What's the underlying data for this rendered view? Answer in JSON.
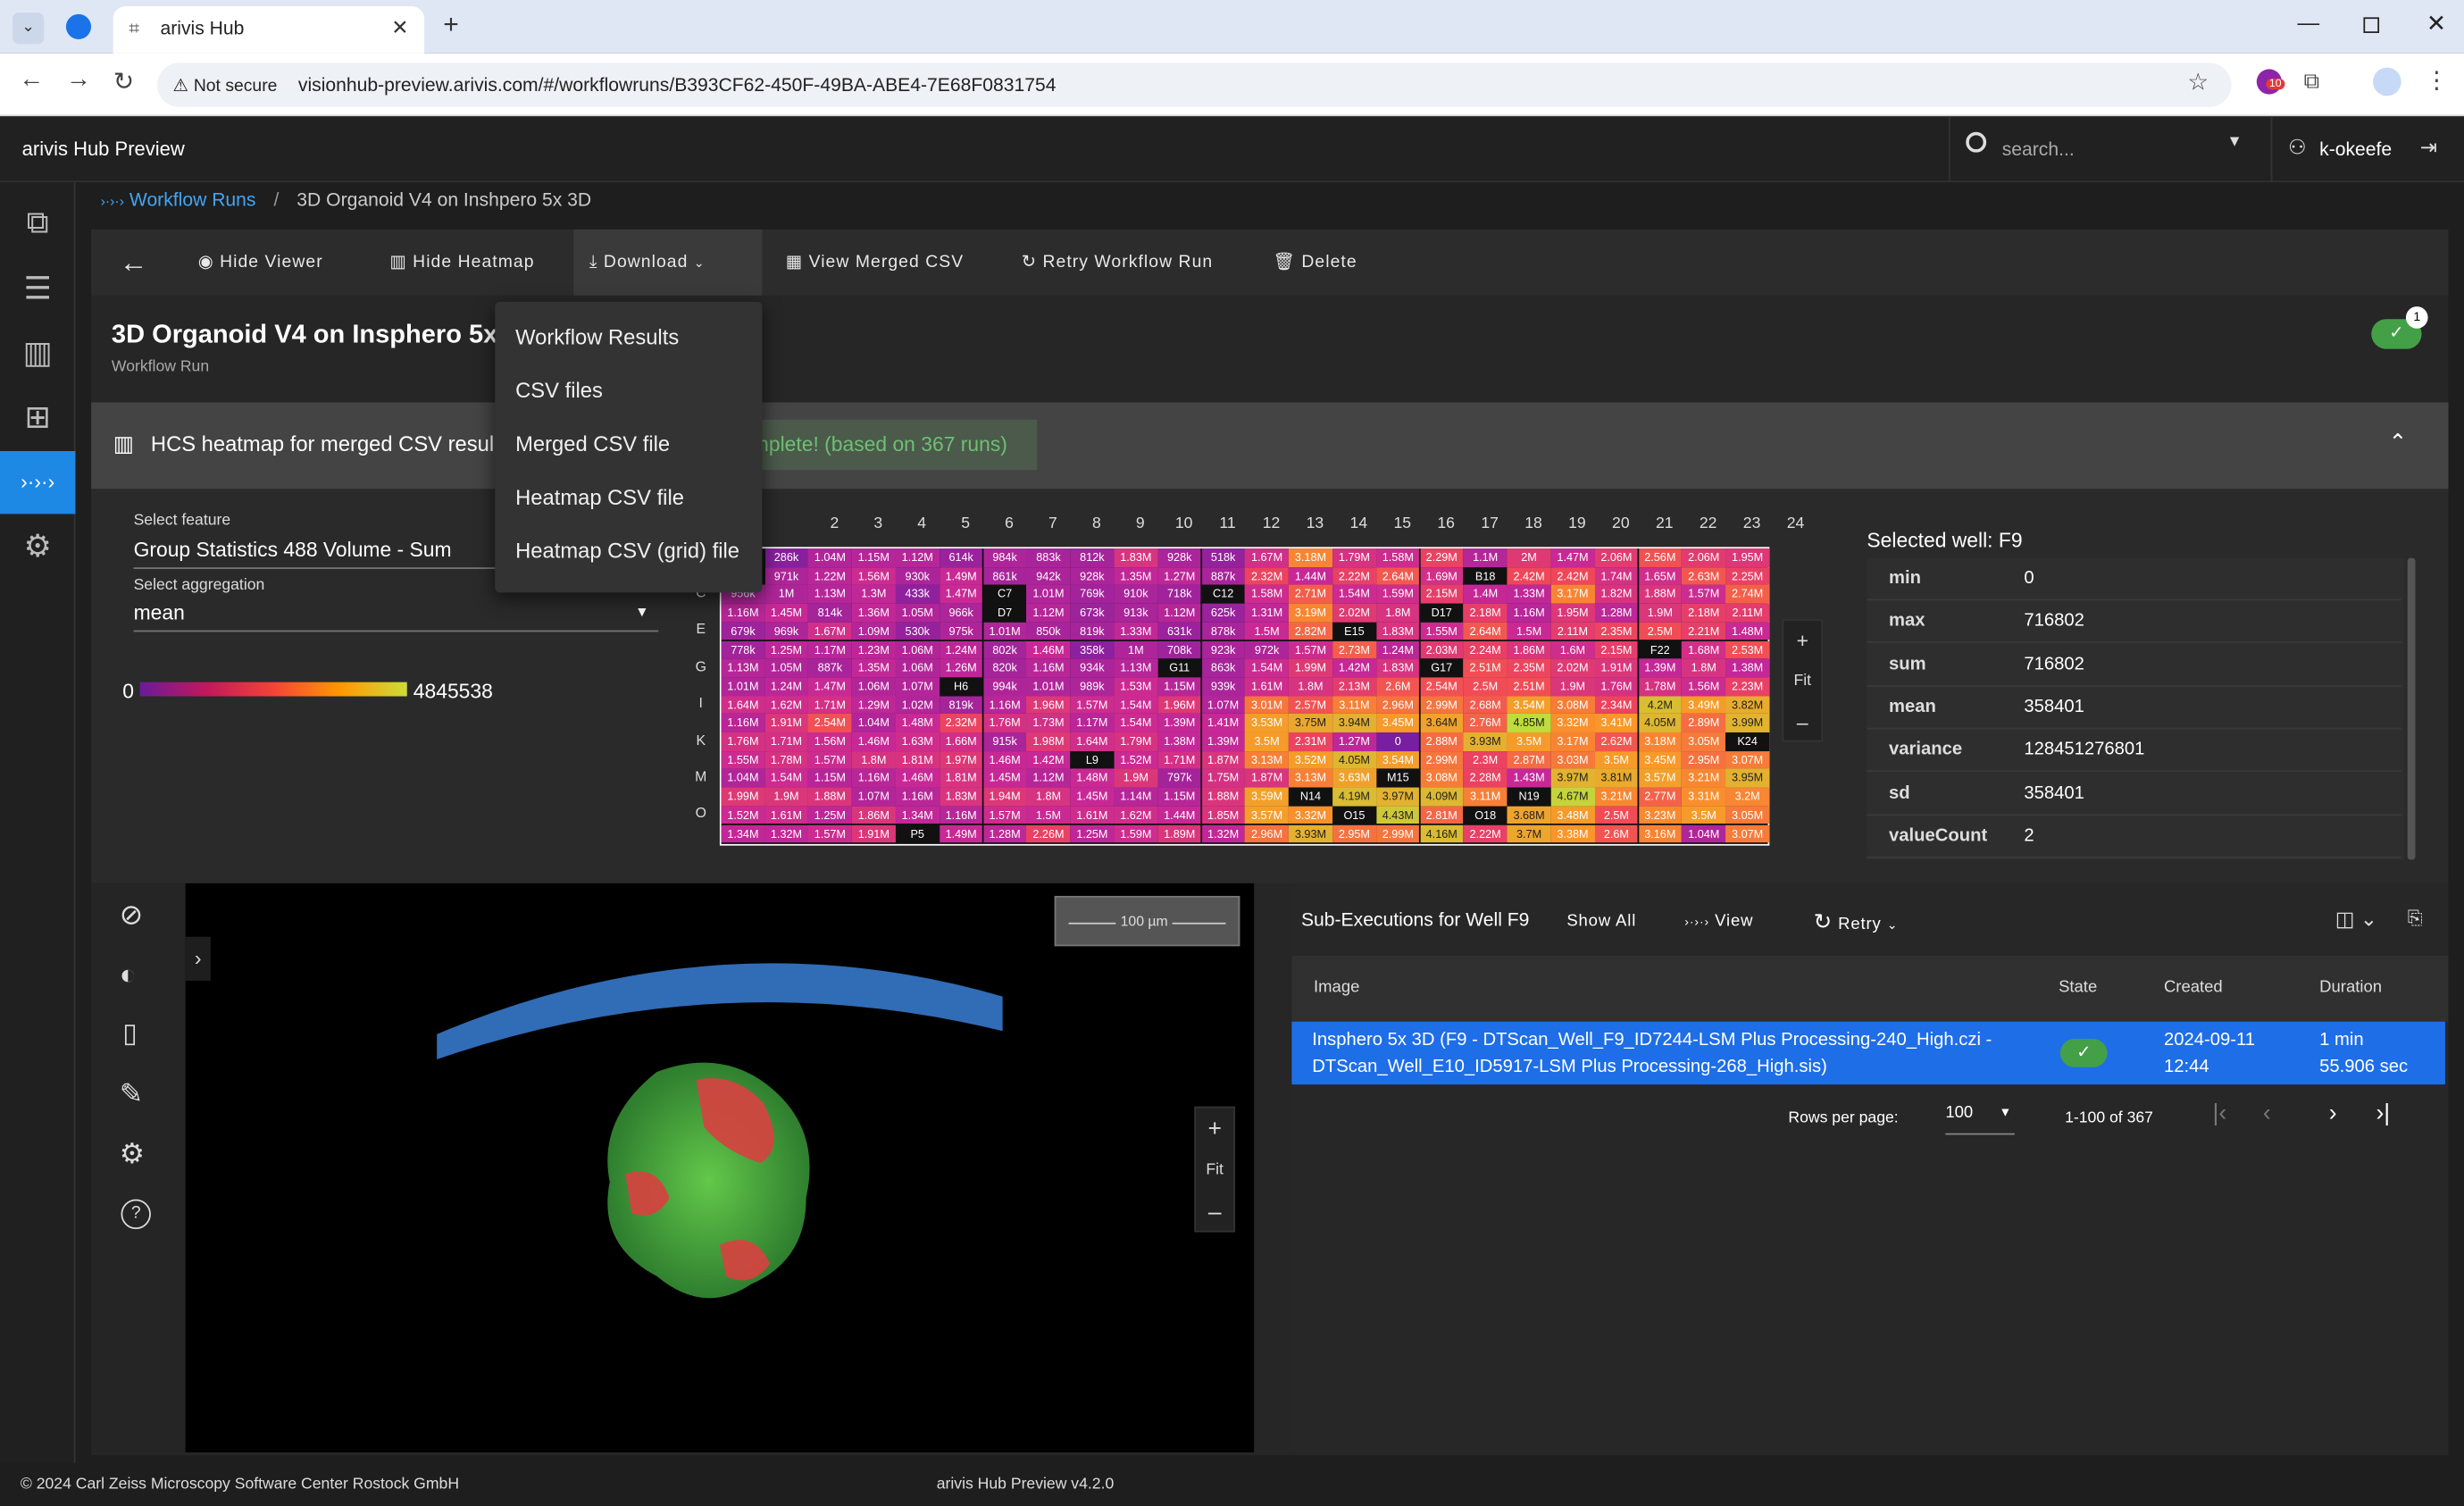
{
  "browser": {
    "tab_title": "arivis Hub",
    "security_label": "Not secure",
    "url": "visionhub-preview.arivis.com/#/workflowruns/B393CF62-450F-49BA-ABE4-7E68F0831754",
    "ext_badge": "10"
  },
  "app": {
    "title": "arivis Hub Preview",
    "search_placeholder": "search...",
    "user": "k-okeefe"
  },
  "breadcrumb": {
    "parent": "Workflow Runs",
    "separator": "/",
    "current": "3D Organoid V4 on Inshpero 5x 3D"
  },
  "toolbar": {
    "hide_viewer": "Hide Viewer",
    "hide_heatmap": "Hide Heatmap",
    "download": "Download",
    "view_merged_csv": "View Merged CSV",
    "retry": "Retry Workflow Run",
    "delete": "Delete"
  },
  "download_menu": [
    "Workflow Results",
    "CSV files",
    "Merged CSV file",
    "Heatmap CSV file",
    "Heatmap CSV (grid) file"
  ],
  "run": {
    "title": "3D Organoid V4 on Insphero 5x",
    "subtitle": "Workflow Run",
    "badge_count": "1"
  },
  "heatmap": {
    "header": "HCS heatmap for merged CSV resul",
    "status": "nplete! (based on 367 runs)",
    "feature_label": "Select feature",
    "feature_value": "Group Statistics 488 Volume - Sum",
    "agg_label": "Select aggregation",
    "agg_value": "mean",
    "scale_min": "0",
    "scale_max": "4845538",
    "columns": [
      "2",
      "3",
      "4",
      "5",
      "6",
      "7",
      "8",
      "9",
      "10",
      "11",
      "12",
      "13",
      "14",
      "15",
      "16",
      "17",
      "18",
      "19",
      "20",
      "21",
      "22",
      "23",
      "24"
    ],
    "row_labels": [
      "C",
      "E",
      "G",
      "I",
      "K",
      "M",
      "O"
    ],
    "zoom_fit": "Fit",
    "rows": [
      [
        "286k",
        "1.04M",
        "1.15M",
        "1.12M",
        "614k",
        "984k",
        "883k",
        "812k",
        "1.83M",
        "928k",
        "518k",
        "1.67M",
        "3.18M",
        "1.79M",
        "1.58M",
        "2.29M",
        "1.1M",
        "2M",
        "1.47M",
        "2.06M",
        "2.56M",
        "2.06M",
        "1.95M"
      ],
      [
        "971k",
        "1.22M",
        "1.56M",
        "930k",
        "1.49M",
        "861k",
        "942k",
        "928k",
        "1.35M",
        "1.27M",
        "887k",
        "2.32M",
        "1.44M",
        "2.22M",
        "2.64M",
        "1.69M",
        "B18",
        "2.42M",
        "2.42M",
        "1.74M",
        "1.65M",
        "2.63M",
        "2.25M"
      ],
      [
        "1M",
        "1.13M",
        "1.3M",
        "433k",
        "1.47M",
        "C7",
        "1.01M",
        "769k",
        "910k",
        "718k",
        "C12",
        "1.58M",
        "2.71M",
        "1.54M",
        "1.59M",
        "2.15M",
        "1.4M",
        "1.33M",
        "3.17M",
        "1.82M",
        "1.88M",
        "1.57M",
        "2.74M"
      ],
      [
        "1.45M",
        "814k",
        "1.36M",
        "1.05M",
        "966k",
        "D7",
        "1.12M",
        "673k",
        "913k",
        "1.12M",
        "625k",
        "1.31M",
        "3.19M",
        "2.02M",
        "1.8M",
        "D17",
        "2.18M",
        "1.16M",
        "1.95M",
        "1.28M",
        "1.9M",
        "2.18M",
        "2.11M"
      ],
      [
        "969k",
        "1.67M",
        "1.09M",
        "530k",
        "975k",
        "1.01M",
        "850k",
        "819k",
        "1.33M",
        "631k",
        "878k",
        "1.5M",
        "2.82M",
        "E15",
        "1.83M",
        "1.55M",
        "2.64M",
        "1.5M",
        "2.11M",
        "2.35M",
        "2.5M",
        "2.21M",
        "1.48M"
      ],
      [
        "1.25M",
        "1.17M",
        "1.23M",
        "1.06M",
        "1.24M",
        "802k",
        "1.46M",
        "358k",
        "1M",
        "708k",
        "923k",
        "972k",
        "1.57M",
        "2.73M",
        "1.24M",
        "2.03M",
        "2.24M",
        "1.86M",
        "1.6M",
        "2.15M",
        "F22",
        "1.68M",
        "2.53M"
      ],
      [
        "1.05M",
        "887k",
        "1.35M",
        "1.06M",
        "1.26M",
        "820k",
        "1.16M",
        "934k",
        "1.13M",
        "G11",
        "863k",
        "1.54M",
        "1.99M",
        "1.42M",
        "1.83M",
        "G17",
        "2.51M",
        "2.35M",
        "2.02M",
        "1.91M",
        "1.39M",
        "1.8M",
        "1.38M"
      ],
      [
        "1.24M",
        "1.47M",
        "1.06M",
        "1.07M",
        "H6",
        "994k",
        "1.01M",
        "989k",
        "1.53M",
        "1.15M",
        "939k",
        "1.61M",
        "1.8M",
        "2.13M",
        "2.6M",
        "2.54M",
        "2.5M",
        "2.51M",
        "1.9M",
        "1.76M",
        "1.78M",
        "1.56M",
        "2.23M"
      ],
      [
        "1.62M",
        "1.71M",
        "1.29M",
        "1.02M",
        "819k",
        "1.16M",
        "1.96M",
        "1.57M",
        "1.54M",
        "1.96M",
        "1.07M",
        "3.01M",
        "2.57M",
        "3.11M",
        "2.96M",
        "2.99M",
        "2.68M",
        "3.54M",
        "3.08M",
        "2.34M",
        "4.2M",
        "3.49M",
        "3.82M"
      ],
      [
        "1.91M",
        "2.54M",
        "1.04M",
        "1.48M",
        "2.32M",
        "1.76M",
        "1.73M",
        "1.17M",
        "1.54M",
        "1.39M",
        "1.41M",
        "3.53M",
        "3.75M",
        "3.94M",
        "3.45M",
        "3.64M",
        "2.76M",
        "4.85M",
        "3.32M",
        "3.41M",
        "4.05M",
        "2.89M",
        "3.99M"
      ],
      [
        "1.71M",
        "1.56M",
        "1.46M",
        "1.63M",
        "1.66M",
        "915k",
        "1.98M",
        "1.64M",
        "1.79M",
        "1.38M",
        "1.39M",
        "3.5M",
        "2.31M",
        "1.27M",
        "0",
        "2.88M",
        "3.93M",
        "3.5M",
        "3.17M",
        "2.62M",
        "3.18M",
        "3.05M",
        "K24"
      ],
      [
        "1.78M",
        "1.57M",
        "1.8M",
        "1.81M",
        "1.97M",
        "1.46M",
        "1.42M",
        "L9",
        "1.52M",
        "1.71M",
        "1.87M",
        "3.13M",
        "3.52M",
        "4.05M",
        "3.54M",
        "2.99M",
        "2.3M",
        "2.87M",
        "3.03M",
        "3.5M",
        "3.45M",
        "2.95M",
        "3.07M"
      ],
      [
        "1.54M",
        "1.15M",
        "1.16M",
        "1.46M",
        "1.81M",
        "1.45M",
        "1.12M",
        "1.48M",
        "1.9M",
        "797k",
        "1.75M",
        "1.87M",
        "3.13M",
        "3.63M",
        "M15",
        "3.08M",
        "2.28M",
        "1.43M",
        "3.97M",
        "3.81M",
        "3.57M",
        "3.21M",
        "3.95M"
      ],
      [
        "1.9M",
        "1.88M",
        "1.07M",
        "1.16M",
        "1.83M",
        "1.94M",
        "1.8M",
        "1.45M",
        "1.14M",
        "1.15M",
        "1.88M",
        "3.59M",
        "N14",
        "4.19M",
        "3.97M",
        "4.09M",
        "3.11M",
        "N19",
        "4.67M",
        "3.21M",
        "2.77M",
        "3.31M",
        "3.2M"
      ],
      [
        "1.61M",
        "1.25M",
        "1.86M",
        "1.34M",
        "1.16M",
        "1.57M",
        "1.5M",
        "1.61M",
        "1.62M",
        "1.44M",
        "1.85M",
        "3.57M",
        "3.32M",
        "O15",
        "4.43M",
        "2.81M",
        "O18",
        "3.68M",
        "3.48M",
        "2.5M",
        "3.23M",
        "3.5M",
        "3.05M"
      ],
      [
        "1.32M",
        "1.57M",
        "1.91M",
        "P5",
        "1.49M",
        "1.28M",
        "2.26M",
        "1.25M",
        "1.59M",
        "1.89M",
        "1.32M",
        "2.96M",
        "3.93M",
        "2.95M",
        "2.99M",
        "4.16M",
        "2.22M",
        "3.7M",
        "3.38M",
        "2.6M",
        "3.16M",
        "1.04M",
        "3.07M"
      ]
    ],
    "edge_col": [
      "",
      "",
      "956k",
      "1.16M",
      "679k",
      "778k",
      "1.13M",
      "1.01M",
      "1.64M",
      "1.16M",
      "1.76M",
      "1.55M",
      "1.04M",
      "1.99M",
      "1.52M",
      "1.34M"
    ],
    "selected_well_title": "Selected well: F9",
    "stats": [
      {
        "k": "min",
        "v": "0"
      },
      {
        "k": "max",
        "v": "716802"
      },
      {
        "k": "sum",
        "v": "716802"
      },
      {
        "k": "mean",
        "v": "358401"
      },
      {
        "k": "variance",
        "v": "128451276801"
      },
      {
        "k": "sd",
        "v": "358401"
      },
      {
        "k": "valueCount",
        "v": "2"
      }
    ]
  },
  "viewer": {
    "scalebar": "100 µm",
    "zoom_fit": "Fit",
    "plus": "+",
    "minus": "–"
  },
  "subexec": {
    "title": "Sub-Executions for Well F9",
    "show_all": "Show All",
    "view": "View",
    "retry": "Retry",
    "col_image": "Image",
    "col_state": "State",
    "col_created": "Created",
    "col_duration": "Duration",
    "row": {
      "image_line1": "Insphero 5x 3D (F9 - DTScan_Well_F9_ID7244-LSM Plus Processing-240_High.czi -",
      "image_line2": "DTScan_Well_E10_ID5917-LSM Plus Processing-268_High.sis)",
      "created_line1": "2024-09-11",
      "created_line2": "12:44",
      "duration_line1": "1 min",
      "duration_line2": "55.906 sec"
    },
    "rows_per_page_label": "Rows per page:",
    "rows_per_page": "100",
    "range": "1-100 of 367"
  },
  "footer": {
    "copyright": "© 2024 Carl Zeiss Microscopy Software Center Rostock GmbH",
    "version": "arivis Hub Preview v4.2.0"
  },
  "colors": {
    "accent": "#2196f3",
    "selected_row": "#1e6ee8",
    "success": "#4caf50"
  }
}
